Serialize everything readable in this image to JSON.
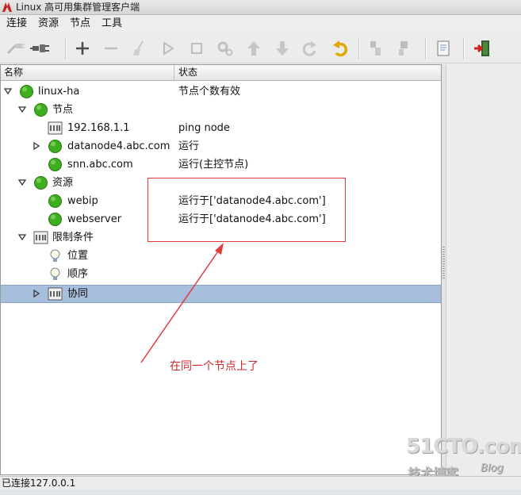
{
  "window": {
    "title": "Linux 高可用集群管理客户端"
  },
  "menubar": {
    "items": [
      "连接",
      "资源",
      "节点",
      "工具"
    ]
  },
  "toolbar": {
    "buttons": [
      "disconnect-icon",
      "connect-icon",
      "add-icon",
      "remove-icon",
      "cleanup-icon",
      "start-icon",
      "stop-icon",
      "configure-icon",
      "move-up-icon",
      "move-down-icon",
      "redo-icon",
      "undo-icon",
      "standby-icon",
      "active-icon",
      "document-icon",
      "exit-icon"
    ]
  },
  "tree": {
    "columns": {
      "name": "名称",
      "status": "状态"
    },
    "rows": [
      {
        "label": "linux-ha",
        "status": "节点个数有效",
        "icon": "green-circle-icon"
      },
      {
        "label": "节点",
        "status": "",
        "icon": "green-circle-icon"
      },
      {
        "label": "192.168.1.1",
        "status": "ping node",
        "icon": "ping-node-icon"
      },
      {
        "label": "datanode4.abc.com",
        "status": "运行",
        "icon": "green-circle-icon"
      },
      {
        "label": "snn.abc.com",
        "status": "运行(主控节点)",
        "icon": "green-circle-icon"
      },
      {
        "label": "资源",
        "status": "",
        "icon": "green-circle-icon"
      },
      {
        "label": "webip",
        "status": "运行于['datanode4.abc.com']",
        "icon": "green-circle-icon"
      },
      {
        "label": "webserver",
        "status": "运行于['datanode4.abc.com']",
        "icon": "green-circle-icon"
      },
      {
        "label": "限制条件",
        "status": "",
        "icon": "constraint-icon"
      },
      {
        "label": "位置",
        "status": "",
        "icon": "lightbulb-icon"
      },
      {
        "label": "顺序",
        "status": "",
        "icon": "lightbulb-icon"
      },
      {
        "label": "协同",
        "status": "",
        "icon": "constraint-icon"
      }
    ]
  },
  "annotation": {
    "text": "在同一个节点上了",
    "color": "#cc2a2a"
  },
  "watermark": {
    "main": "51CTO.com",
    "sub": "技术博客",
    "blog": "Blog"
  },
  "statusbar": {
    "text": "已连接127.0.0.1"
  },
  "colors": {
    "selection": "#a7bedc",
    "status_green": "#3fae1e",
    "annotation_red": "#e23a3a"
  }
}
